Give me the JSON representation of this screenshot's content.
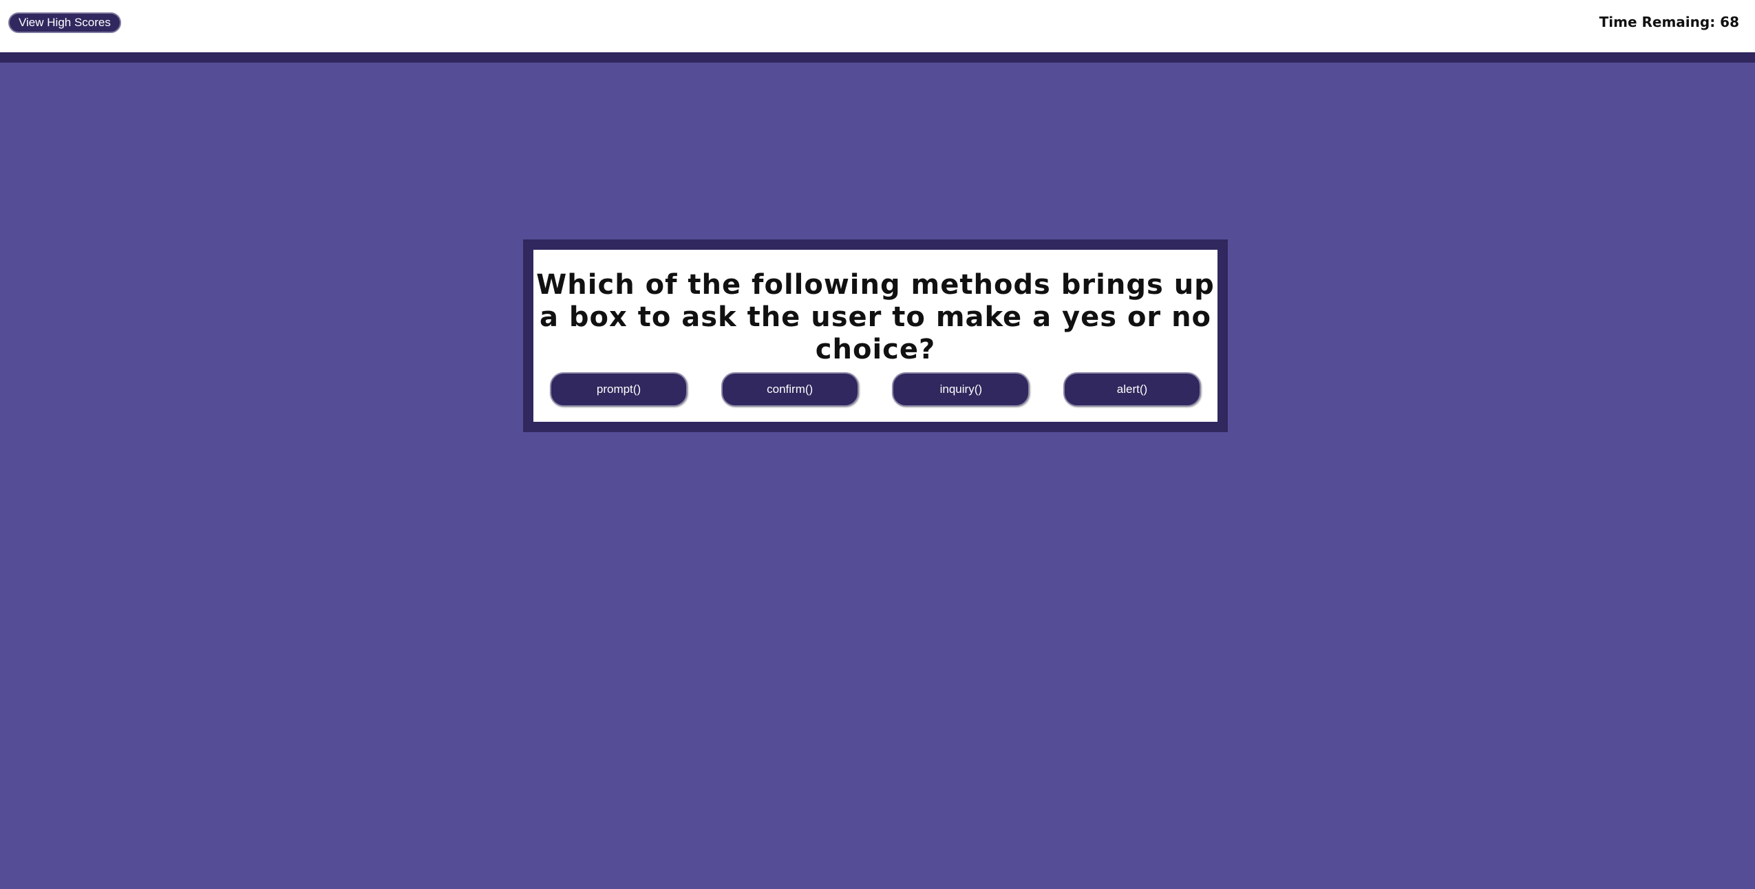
{
  "header": {
    "high_scores_label": "View High Scores",
    "timer_text": "Time Remaing: 68"
  },
  "quiz": {
    "question": "Which of the following methods brings up a box to ask the user to make a yes or no choice?",
    "answers": [
      "prompt()",
      "confirm()",
      "inquiry()",
      "alert()"
    ]
  },
  "colors": {
    "background": "#554e96",
    "accent_dark": "#30285e",
    "card": "#ffffff"
  }
}
